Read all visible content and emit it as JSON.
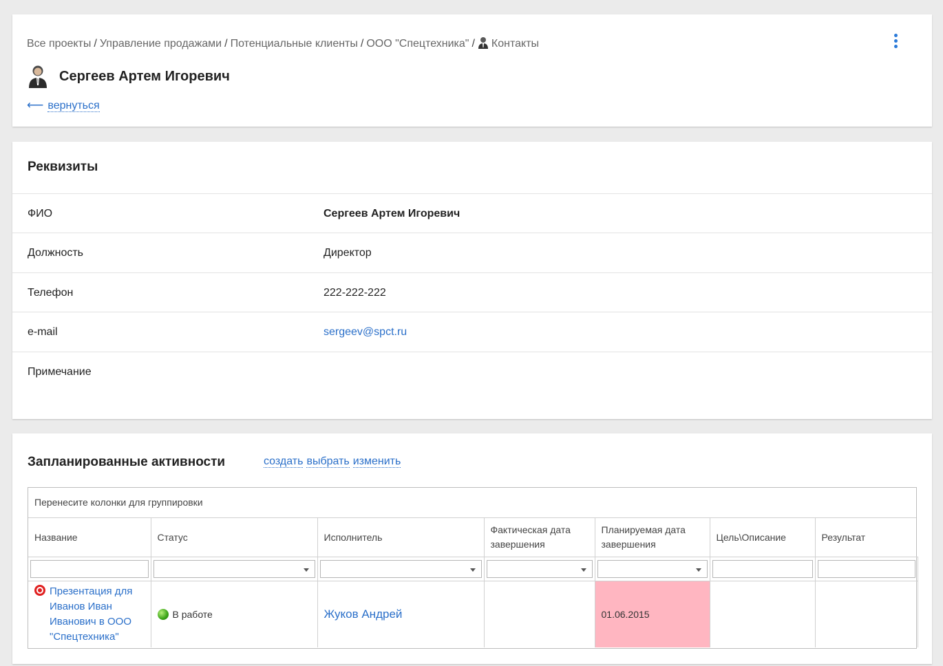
{
  "header": {
    "breadcrumb": [
      "Все проекты",
      "Управление продажами",
      "Потенциальные клиенты",
      "ООО \"Спецтехника\""
    ],
    "breadcrumb_last": "Контакты",
    "title": "Сергеев Артем Игоревич",
    "back_arrow": "⟵",
    "back_label": "вернуться",
    "more_icon": "vertical-ellipsis-icon"
  },
  "requisites": {
    "title": "Реквизиты",
    "rows": [
      {
        "label": "ФИО",
        "value": "Сергеев Артем Игоревич"
      },
      {
        "label": "Должность",
        "value": "Директор"
      },
      {
        "label": "Телефон",
        "value": "222-222-222"
      },
      {
        "label": "e-mail",
        "value": "sergeev@spct.ru"
      },
      {
        "label": "Примечание",
        "value": ""
      }
    ]
  },
  "activities": {
    "title": "Запланированные активности",
    "actions": [
      "создать",
      "выбрать",
      "изменить"
    ],
    "group_hint": "Перенесите колонки для группировки",
    "columns": [
      "Название",
      "Статус",
      "Исполнитель",
      "Фактическая дата завершения",
      "Планируемая дата завершения",
      "Цель\\Описание",
      "Результат"
    ],
    "rows": [
      {
        "name": "Презентация для Иванов Иван Иванович в ООО \"Спецтехника\"",
        "status": "В работе",
        "executor": "Жуков Андрей",
        "actual_date": "",
        "planned_date": "01.06.2015",
        "goal": "",
        "result": ""
      }
    ],
    "colors": {
      "overdue": "#ffb6c1",
      "link": "#2a6fc9"
    }
  }
}
